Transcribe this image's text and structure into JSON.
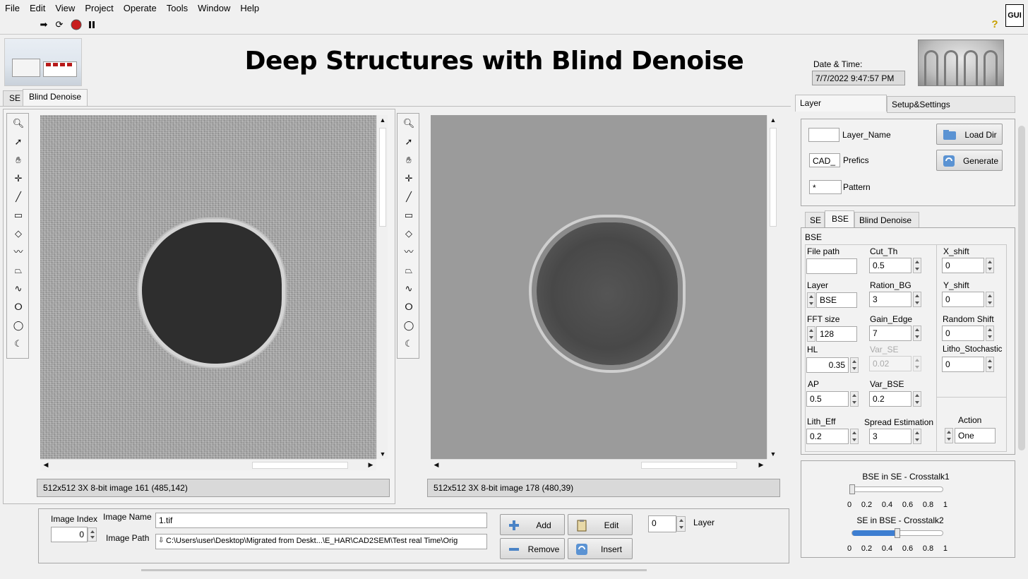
{
  "menu": [
    "File",
    "Edit",
    "View",
    "Project",
    "Operate",
    "Tools",
    "Window",
    "Help"
  ],
  "toolbar": {
    "run_icon": "run-arrow-icon",
    "run_cont_icon": "run-continuously-icon",
    "abort_icon": "abort-icon",
    "pause_icon": "pause-icon",
    "help_icon": "?",
    "gui_badge": "GUI"
  },
  "header": {
    "title": "Deep Structures with Blind Denoise",
    "datetime_label": "Date & Time:",
    "datetime_value": "7/7/2022 9:47:57 PM"
  },
  "main_tabs": [
    "SE",
    "Blind Denoise"
  ],
  "left_panel": {
    "status": "512x512 3X 8-bit image 161     (485,142)"
  },
  "right_image_panel": {
    "status": "512x512 3X 8-bit image 178     (480,39)"
  },
  "tools": [
    "zoom-icon",
    "pointer-icon",
    "pan-hand-icon",
    "crosshair-icon",
    "line-icon",
    "rectangle-icon",
    "rotated-rect-icon",
    "polyline-icon",
    "polygon-icon",
    "freehand-line-icon",
    "freehand-region-icon",
    "oval-icon",
    "annulus-icon"
  ],
  "bottom": {
    "image_index_label": "Image Index",
    "image_index_value": "0",
    "image_name_label": "Image Name",
    "image_name_value": "1.tif",
    "image_path_label": "Image Path",
    "image_path_value": "C:\\Users\\user\\Desktop\\Migrated from Deskt...\\E_HAR\\CAD2SEM\\Test real Time\\Orig",
    "add_label": "Add",
    "edit_label": "Edit",
    "remove_label": "Remove",
    "insert_label": "Insert",
    "layer_value": "0",
    "layer_label": "Layer"
  },
  "right": {
    "tabs": [
      "Layer",
      "Setup&Settings"
    ],
    "layer_name_label": "Layer_Name",
    "layer_name_value": "",
    "prefics_label": "Prefics",
    "prefics_value": "CAD_",
    "pattern_label": "Pattern",
    "pattern_value": "*",
    "load_dir_label": "Load Dir",
    "generate_label": "Generate",
    "sub_tabs": [
      "SE",
      "BSE",
      "Blind Denoise"
    ],
    "group_title": "BSE",
    "params": {
      "file_path_label": "File path",
      "file_path_value": "",
      "cut_th_label": "Cut_Th",
      "cut_th_value": "0.5",
      "x_shift_label": "X_shift",
      "x_shift_value": "0",
      "layer_label": "Layer",
      "layer_value": "BSE",
      "ration_bg_label": "Ration_BG",
      "ration_bg_value": "3",
      "y_shift_label": "Y_shift",
      "y_shift_value": "0",
      "fft_size_label": "FFT size",
      "fft_size_value": "128",
      "gain_edge_label": "Gain_Edge",
      "gain_edge_value": "7",
      "random_shift_label": "Random Shift",
      "random_shift_value": "0",
      "hl_label": "HL",
      "hl_value": "0.35",
      "var_se_label": "Var_SE",
      "var_se_value": "0.02",
      "litho_label": "Litho_Stochastic",
      "litho_value": "0",
      "ap_label": "AP",
      "ap_value": "0.5",
      "var_bse_label": "Var_BSE",
      "var_bse_value": "0.2",
      "lith_eff_label": "Lith_Eff",
      "lith_eff_value": "0.2",
      "spread_label": "Spread Estimation",
      "spread_value": "3",
      "action_label": "Action",
      "action_value": "One"
    },
    "crosstalk1": {
      "label": "BSE in SE - Crosstalk1",
      "value": 0.0
    },
    "crosstalk2": {
      "label": "SE in BSE - Crosstalk2",
      "value": 0.5
    },
    "ticks": [
      "0",
      "0.2",
      "0.4",
      "0.6",
      "0.8",
      "1"
    ]
  },
  "colors": {
    "accent": "#3d7ed1",
    "abort": "#c81e1e"
  }
}
